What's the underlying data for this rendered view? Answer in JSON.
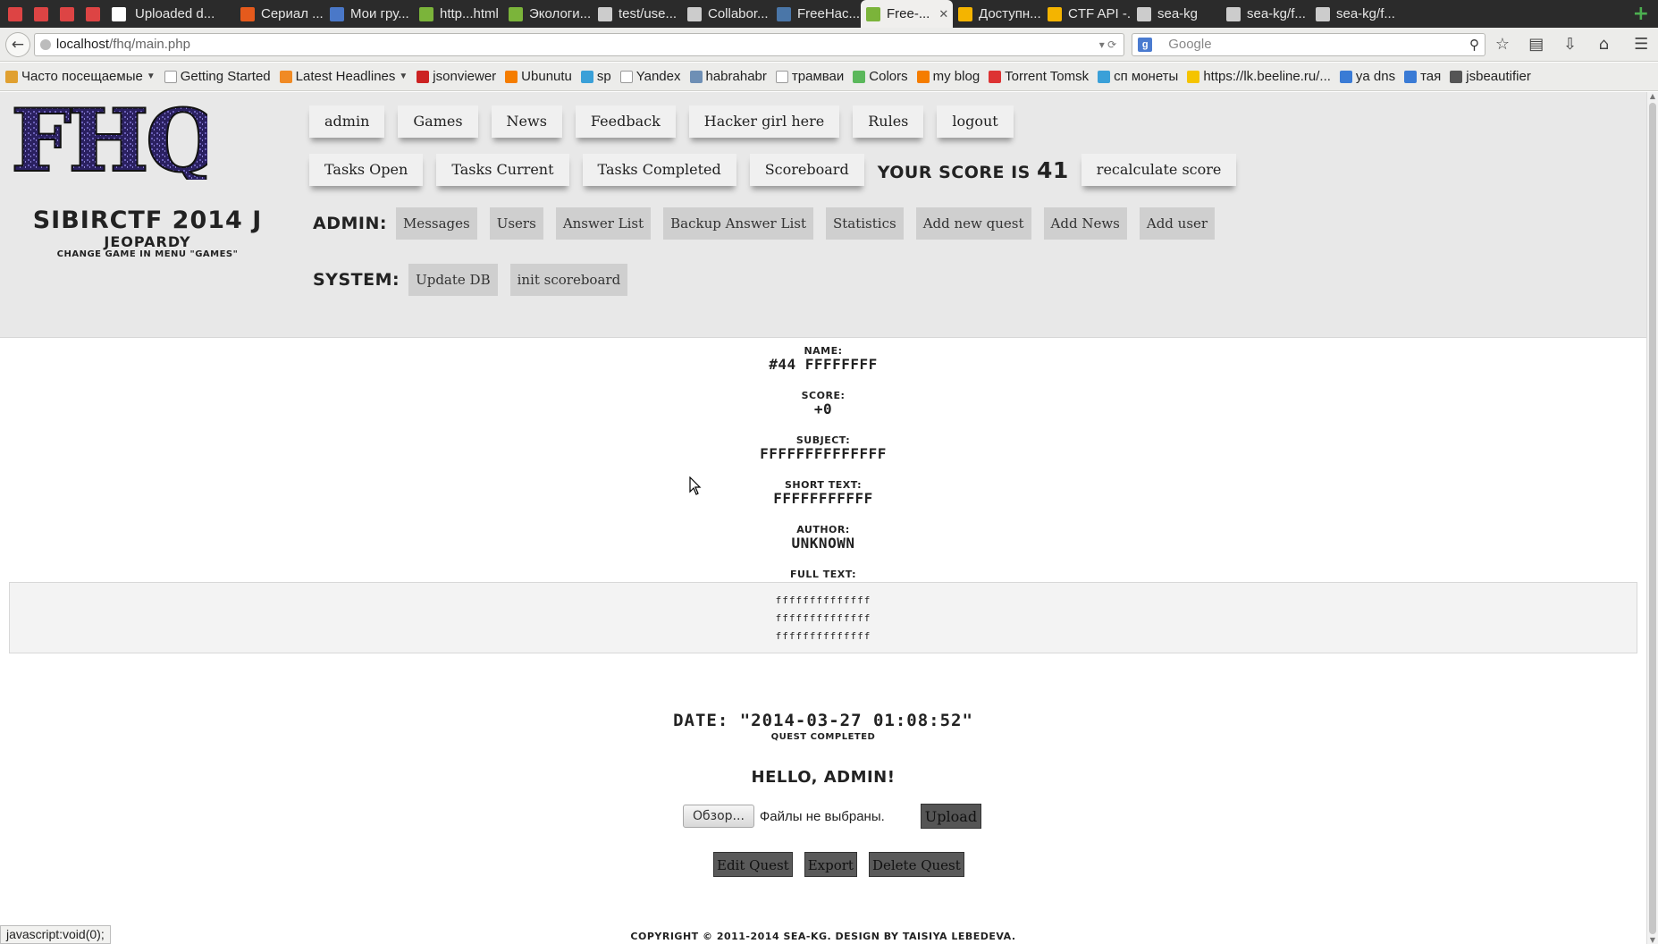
{
  "browser": {
    "tabs": [
      {
        "label": "",
        "favicon": "mail-icon",
        "color": "#d44",
        "pinned": true
      },
      {
        "label": "",
        "favicon": "gmail-icon",
        "color": "#d44",
        "pinned": true
      },
      {
        "label": "",
        "favicon": "gmail-icon",
        "color": "#d44",
        "pinned": true
      },
      {
        "label": "",
        "favicon": "gmail-icon",
        "color": "#d44",
        "pinned": true
      },
      {
        "label": "",
        "favicon": "play-icon",
        "color": "#fff",
        "pinned": true
      },
      {
        "label": "Uploaded d...",
        "favicon": "",
        "color": "#2b2b2b",
        "pinned": false
      },
      {
        "label": "Сериал ...",
        "favicon": "flame-icon",
        "color": "#e55a1c",
        "pinned": false
      },
      {
        "label": "Мои гру...",
        "favicon": "doc-icon",
        "color": "#4a78c8",
        "pinned": false
      },
      {
        "label": "http...html",
        "favicon": "leaf-icon",
        "color": "#7bb43a",
        "pinned": false
      },
      {
        "label": "Экологи...",
        "favicon": "leaf-icon",
        "color": "#7bb43a",
        "pinned": false
      },
      {
        "label": "test/use...",
        "favicon": "github-icon",
        "color": "#ccc",
        "pinned": false
      },
      {
        "label": "Collabor...",
        "favicon": "github-icon",
        "color": "#ccc",
        "pinned": false
      },
      {
        "label": "FreeHac...",
        "favicon": "vk-icon",
        "color": "#4a76a8",
        "pinned": false
      },
      {
        "label": "Free-...",
        "favicon": "leaf-icon",
        "color": "#7bb43a",
        "pinned": false,
        "active": true
      },
      {
        "label": "Доступн...",
        "favicon": "drive-icon",
        "color": "#f4b400",
        "pinned": false
      },
      {
        "label": "CTF API -...",
        "favicon": "drive-icon",
        "color": "#f4b400",
        "pinned": false
      },
      {
        "label": "sea-kg",
        "favicon": "github-icon",
        "color": "#ccc",
        "pinned": false
      },
      {
        "label": "sea-kg/f...",
        "favicon": "github-icon",
        "color": "#ccc",
        "pinned": false
      },
      {
        "label": "sea-kg/f...",
        "favicon": "github-icon",
        "color": "#ccc",
        "pinned": false
      }
    ],
    "url_host": "localhost",
    "url_path": "/fhq/main.php",
    "search_placeholder": "Google",
    "bookmarks": [
      {
        "label": "Часто посещаемые",
        "icon": "folder-icon",
        "color": "#e0a030",
        "dropdown": true
      },
      {
        "label": "Getting Started",
        "icon": "page-icon",
        "color": "#ffffff",
        "dropdown": false
      },
      {
        "label": "Latest Headlines",
        "icon": "rss-icon",
        "color": "#f08a24",
        "dropdown": true
      },
      {
        "label": "jsonviewer",
        "icon": "opera-icon",
        "color": "#cc2222",
        "dropdown": false
      },
      {
        "label": "Ubunutu",
        "icon": "blogger-icon",
        "color": "#f57d00",
        "dropdown": false
      },
      {
        "label": "sp",
        "icon": "swap-icon",
        "color": "#3aa0d8",
        "dropdown": false
      },
      {
        "label": "Yandex",
        "icon": "yandex-icon",
        "color": "#ffffff",
        "dropdown": false
      },
      {
        "label": "habrahabr",
        "icon": "habr-icon",
        "color": "#6e8fb5",
        "dropdown": false
      },
      {
        "label": "трамваи",
        "icon": "page-icon",
        "color": "#ffffff",
        "dropdown": false
      },
      {
        "label": "Colors",
        "icon": "colors-icon",
        "color": "#5bb85b",
        "dropdown": false
      },
      {
        "label": "my blog",
        "icon": "blogger-icon",
        "color": "#f57d00",
        "dropdown": false
      },
      {
        "label": "Torrent Tomsk",
        "icon": "star-icon",
        "color": "#d33",
        "dropdown": false
      },
      {
        "label": "сп монеты",
        "icon": "swap-icon",
        "color": "#3aa0d8",
        "dropdown": false
      },
      {
        "label": "https://lk.beeline.ru/...",
        "icon": "beeline-icon",
        "color": "#f5c400",
        "dropdown": false
      },
      {
        "label": "ya dns",
        "icon": "mail-icon",
        "color": "#3a7bd5",
        "dropdown": false
      },
      {
        "label": "тая",
        "icon": "flag-icon",
        "color": "#3a7bd5",
        "dropdown": false
      },
      {
        "label": "jsbeautifier",
        "icon": "clock-icon",
        "color": "#555555",
        "dropdown": false
      }
    ],
    "status_text": "javascript:void(0);"
  },
  "header": {
    "logo_text": "FHQ",
    "title": "SIBIRCTF 2014 J",
    "subtitle": "JEOPARDY",
    "hint": "CHANGE GAME IN MENU \"GAMES\"",
    "menu_row1": [
      "admin",
      "Games",
      "News",
      "Feedback",
      "Hacker girl here",
      "Rules",
      "logout"
    ],
    "menu_row2": [
      "Tasks Open",
      "Tasks Current",
      "Tasks Completed",
      "Scoreboard"
    ],
    "score_label": "YOUR SCORE IS",
    "score_value": "41",
    "recalculate_label": "recalculate score",
    "admin_label": "ADMIN:",
    "admin_items": [
      "Messages",
      "Users",
      "Answer List",
      "Backup Answer List",
      "Statistics",
      "Add new quest",
      "Add News",
      "Add user"
    ],
    "system_label": "SYSTEM:",
    "system_items": [
      "Update DB",
      "init scoreboard"
    ]
  },
  "quest": {
    "name_label": "NAME:",
    "name_value": "#44 FFFFFFFF",
    "score_label": "SCORE:",
    "score_value": "+0",
    "subject_label": "SUBJECT:",
    "subject_value": "FFFFFFFFFFFFFF",
    "short_text_label": "SHORT TEXT:",
    "short_text_value": "FFFFFFFFFFF",
    "author_label": "AUTHOR:",
    "author_value": "UNKNOWN",
    "full_text_label": "FULL TEXT:",
    "full_text_lines": [
      "ffffffffffffff",
      "ffffffffffffff",
      "ffffffffffffff"
    ],
    "date_line": "DATE: \"2014-03-27 01:08:52\"",
    "completed_text": "QUEST COMPLETED",
    "hello_text": "HELLO, ADMIN!",
    "browse_label": "Обзор...",
    "no_file_text": "Файлы не выбраны.",
    "upload_label": "Upload",
    "actions": [
      "Edit Quest",
      "Export",
      "Delete Quest"
    ]
  },
  "footer": {
    "copyright": "COPYRIGHT © 2011-2014 SEA-KG. DESIGN BY TAISIYA LEBEDEVA."
  }
}
